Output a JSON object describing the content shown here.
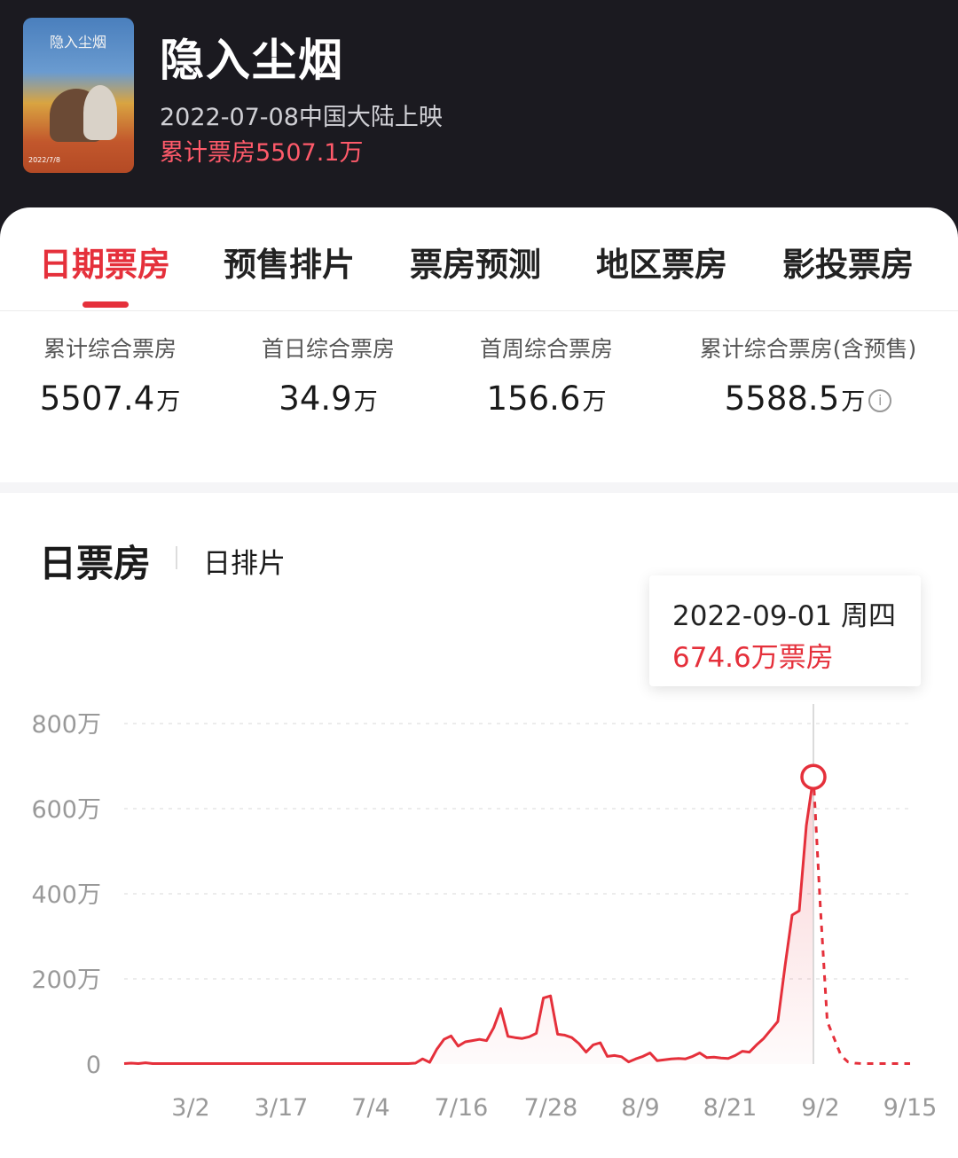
{
  "movie": {
    "title": "隐入尘烟",
    "release": "2022-07-08中国大陆上映",
    "total_label": "累计票房",
    "total_value": "5507.1万",
    "poster_text": "隐入尘烟",
    "poster_caption": "2022/7/8"
  },
  "tabs": [
    {
      "label": "日期票房",
      "active": true
    },
    {
      "label": "预售排片",
      "active": false
    },
    {
      "label": "票房预测",
      "active": false
    },
    {
      "label": "地区票房",
      "active": false
    },
    {
      "label": "影投票房",
      "active": false
    }
  ],
  "stats": [
    {
      "label": "累计综合票房",
      "value": "5507.4",
      "unit": "万"
    },
    {
      "label": "首日综合票房",
      "value": "34.9",
      "unit": "万"
    },
    {
      "label": "首周综合票房",
      "value": "156.6",
      "unit": "万"
    },
    {
      "label": "累计综合票房(含预售)",
      "value": "5588.5",
      "unit": "万"
    }
  ],
  "chart_header": {
    "title": "日票房",
    "subtab": "日排片"
  },
  "tooltip": {
    "date": "2022-09-01 周四",
    "value": "674.6万票房"
  },
  "colors": {
    "accent": "#e5303b",
    "header_bg": "#1b1a20"
  },
  "chart_data": {
    "type": "area",
    "title": "",
    "xlabel": "",
    "ylabel": "",
    "y_ticks": [
      "800万",
      "600万",
      "400万",
      "200万",
      "0"
    ],
    "ylim": [
      0,
      800
    ],
    "x_ticks": [
      "3/2",
      "3/17",
      "7/4",
      "7/16",
      "7/28",
      "8/9",
      "8/21",
      "9/2",
      "9/15"
    ],
    "grid": true,
    "series": [
      {
        "values": [
          1,
          2,
          1,
          3,
          1,
          1,
          1,
          1,
          1,
          1,
          1,
          1,
          1,
          1,
          1,
          1,
          1,
          1,
          1,
          1,
          1,
          1,
          1,
          1,
          1,
          1,
          1,
          1,
          1,
          1,
          1,
          1,
          1,
          1,
          1,
          1,
          1,
          1,
          1,
          1,
          1,
          2,
          12,
          4,
          35,
          58,
          66,
          42,
          52,
          55,
          58,
          55,
          85,
          130,
          65,
          62,
          60,
          64,
          72,
          155,
          160,
          70,
          68,
          62,
          48,
          28,
          45,
          50,
          18,
          20,
          17,
          5,
          12,
          18,
          26,
          8,
          10,
          12,
          13,
          12,
          18,
          26,
          15,
          16,
          14,
          13,
          20,
          30,
          28,
          45,
          60,
          80,
          100,
          230,
          350,
          360,
          560,
          674.6
        ],
        "forecast": [
          370,
          100,
          60,
          20,
          5,
          2,
          1,
          1,
          1,
          1,
          1,
          1,
          1,
          1
        ]
      }
    ],
    "highlight": {
      "date": "2022-09-01",
      "value": 674.6
    }
  }
}
